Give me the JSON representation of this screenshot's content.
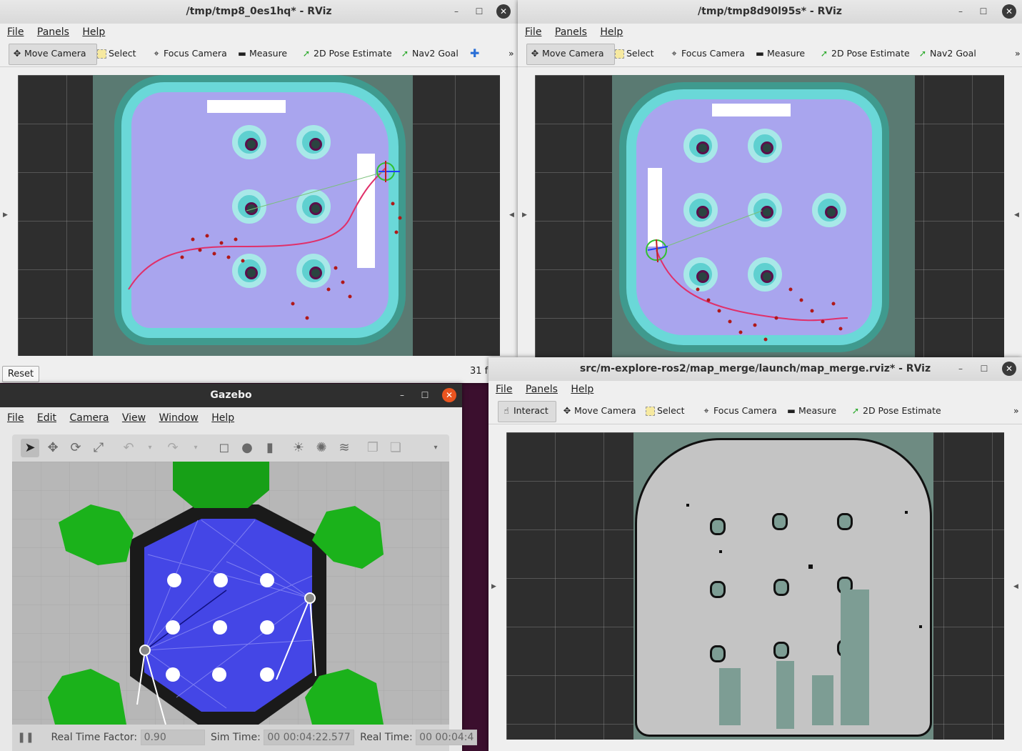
{
  "rviz_left": {
    "title": "/tmp/tmp8_0es1hq* - RViz",
    "menu": [
      "File",
      "Panels",
      "Help"
    ],
    "tools": [
      "Move Camera",
      "Select",
      "Focus Camera",
      "Measure",
      "2D Pose Estimate",
      "Nav2 Goal"
    ],
    "reset_label": "Reset",
    "fps_text": "31 f"
  },
  "rviz_right": {
    "title": "/tmp/tmp8d90l95s* - RViz",
    "menu": [
      "File",
      "Panels",
      "Help"
    ],
    "tools": [
      "Move Camera",
      "Select",
      "Focus Camera",
      "Measure",
      "2D Pose Estimate",
      "Nav2 Goal"
    ]
  },
  "gazebo": {
    "title": "Gazebo",
    "menu": [
      "File",
      "Edit",
      "Camera",
      "View",
      "Window",
      "Help"
    ],
    "real_time_factor_label": "Real Time Factor:",
    "real_time_factor": "0.90",
    "sim_time_label": "Sim Time:",
    "sim_time": "00 00:04:22.577",
    "real_time_label": "Real Time:",
    "real_time": "00 00:04:4"
  },
  "map_merge": {
    "title": "src/m-explore-ros2/map_merge/launch/map_merge.rviz* - RViz",
    "menu": [
      "File",
      "Panels",
      "Help"
    ],
    "tools": [
      "Interact",
      "Move Camera",
      "Select",
      "Focus Camera",
      "Measure",
      "2D Pose Estimate"
    ]
  },
  "icons": {
    "minimize": "minimize-icon",
    "maximize": "maximize-icon",
    "close": "close-icon"
  }
}
